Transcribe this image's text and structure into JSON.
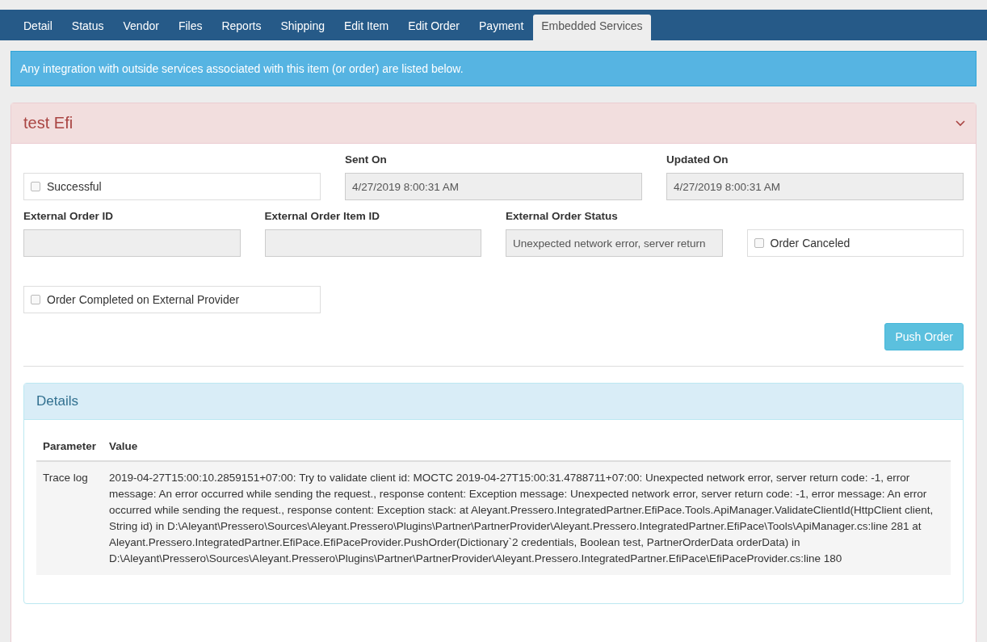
{
  "tabs": [
    {
      "label": "Detail",
      "selected": false
    },
    {
      "label": "Status",
      "selected": false
    },
    {
      "label": "Vendor",
      "selected": false
    },
    {
      "label": "Files",
      "selected": false
    },
    {
      "label": "Reports",
      "selected": false
    },
    {
      "label": "Shipping",
      "selected": false
    },
    {
      "label": "Edit Item",
      "selected": false
    },
    {
      "label": "Edit Order",
      "selected": false
    },
    {
      "label": "Payment",
      "selected": false
    },
    {
      "label": "Embedded Services",
      "selected": true
    }
  ],
  "notice": "Any integration with outside services associated with this item (or order) are listed below.",
  "service": {
    "title": "test Efi",
    "rows": [
      [
        {
          "kind": "checkbox",
          "label": "Successful",
          "checked": false
        },
        {
          "kind": "text",
          "label": "Sent On",
          "value": "4/27/2019 8:00:31 AM"
        },
        {
          "kind": "text",
          "label": "Updated On",
          "value": "4/27/2019 8:00:31 AM"
        }
      ],
      [
        {
          "kind": "text",
          "label": "External Order ID"
        },
        {
          "kind": "text",
          "label": "External Order Item ID"
        },
        {
          "kind": "text",
          "label": "External Order Status",
          "value": "Unexpected network error, server return"
        },
        {
          "kind": "checkbox",
          "label": "Order Canceled",
          "checked": false
        }
      ],
      [
        {
          "kind": "checkbox",
          "label": "Order Completed on External Provider",
          "checked": false
        }
      ]
    ],
    "button": "Push Order",
    "details": {
      "title": "Details",
      "columns": [
        "Parameter",
        "Value"
      ],
      "rows": [
        {
          "parameter": "Trace log",
          "value": "2019-04-27T15:00:10.2859151+07:00: Try to validate client id: MOCTC 2019-04-27T15:00:31.4788711+07:00: Unexpected network error, server return code: -1, error message: An error occurred while sending the request., response content: Exception message: Unexpected network error, server return code: -1, error message: An error occurred while sending the request., response content: Exception stack: at Aleyant.Pressero.IntegratedPartner.EfiPace.Tools.ApiManager.ValidateClientId(HttpClient client, String id) in D:\\Aleyant\\Pressero\\Sources\\Aleyant.Pressero\\Plugins\\Partner\\PartnerProvider\\Aleyant.Pressero.IntegratedPartner.EfiPace\\Tools\\ApiManager.cs:line 281 at Aleyant.Pressero.IntegratedPartner.EfiPace.EfiPaceProvider.PushOrder(Dictionary`2 credentials, Boolean test, PartnerOrderData orderData) in D:\\Aleyant\\Pressero\\Sources\\Aleyant.Pressero\\Plugins\\Partner\\PartnerProvider\\Aleyant.Pressero.IntegratedPartner.EfiPace\\EfiPaceProvider.cs:line 180"
        }
      ]
    }
  }
}
